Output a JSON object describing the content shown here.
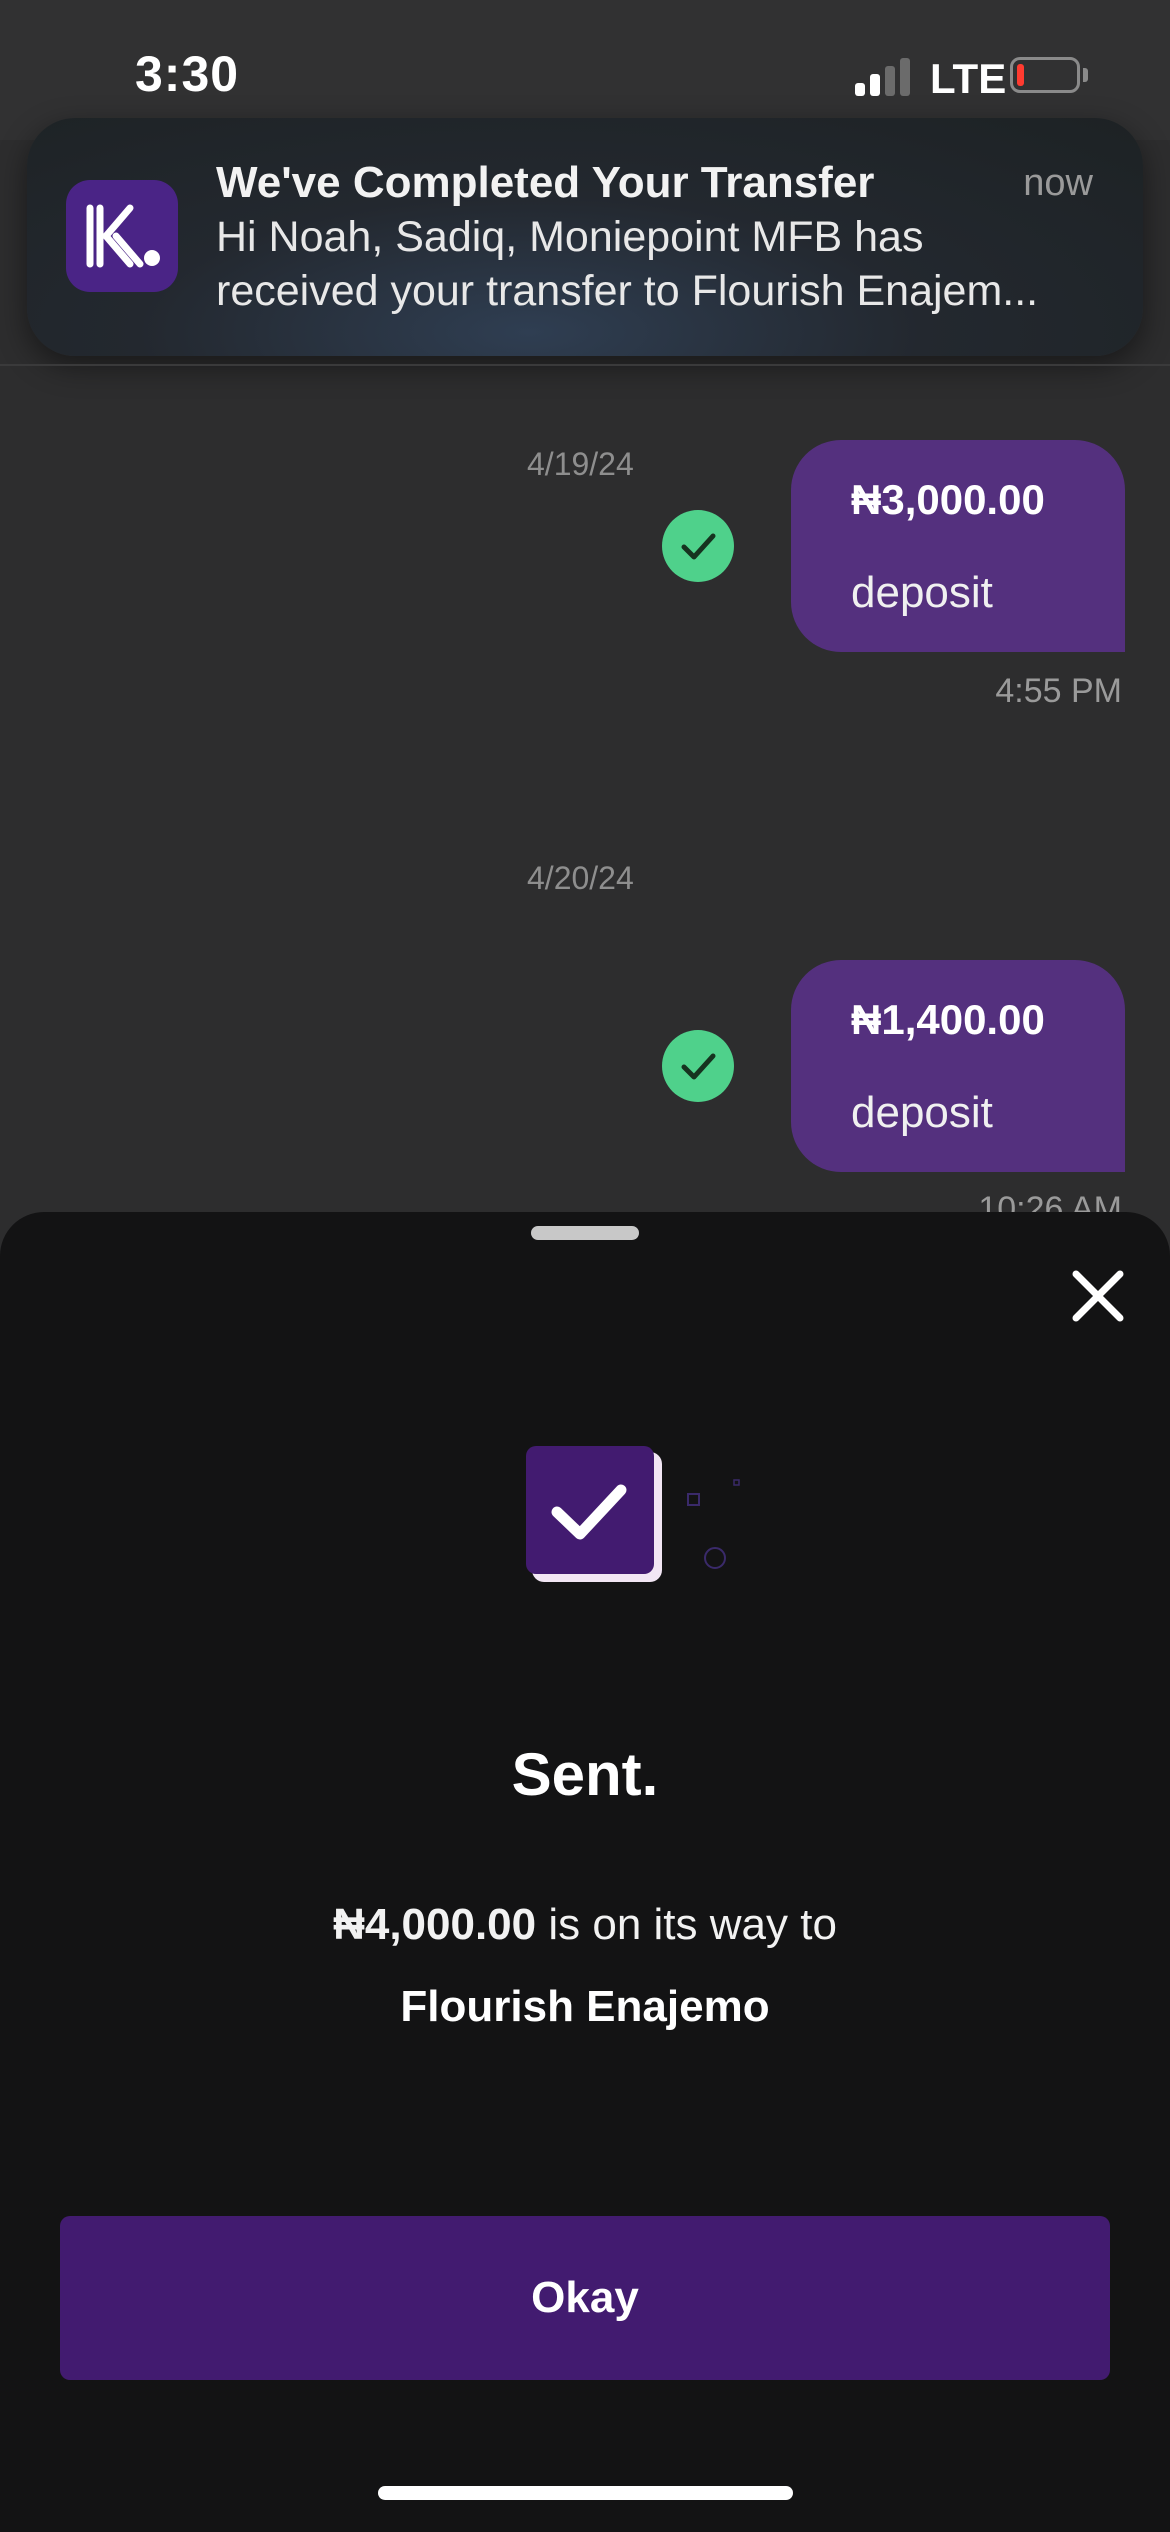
{
  "status_bar": {
    "time": "3:30",
    "network": "LTE",
    "signal_bars_active": 2,
    "signal_bars_total": 4,
    "battery_level": "low",
    "battery_color": "#ff3b30"
  },
  "notification": {
    "app_icon": "moniepoint-kuda-logo",
    "title": "We've Completed Your Transfer",
    "time": "now",
    "body_line1": "Hi Noah, Sadiq, Moniepoint MFB has",
    "body_line2": "received your transfer to Flourish Enajem..."
  },
  "transactions": [
    {
      "date": "4/19/24",
      "amount": "₦3,000.00",
      "type": "deposit",
      "time": "4:55 PM",
      "status_icon": "check-circle-icon"
    },
    {
      "date": "4/20/24",
      "amount": "₦1,400.00",
      "type": "deposit",
      "time": "10:26 AM",
      "status_icon": "check-circle-icon"
    }
  ],
  "sheet": {
    "close_icon": "close-icon",
    "success_icon": "checkbox-check-icon",
    "title": "Sent.",
    "amount": "₦4,000.00",
    "message_suffix": " is on its way to",
    "recipient": "Flourish Enajemo",
    "button_label": "Okay"
  },
  "colors": {
    "accent_purple": "#421b70",
    "bubble_purple": "#54307e",
    "success_green": "#4fd18b",
    "sheet_background": "#131314"
  }
}
